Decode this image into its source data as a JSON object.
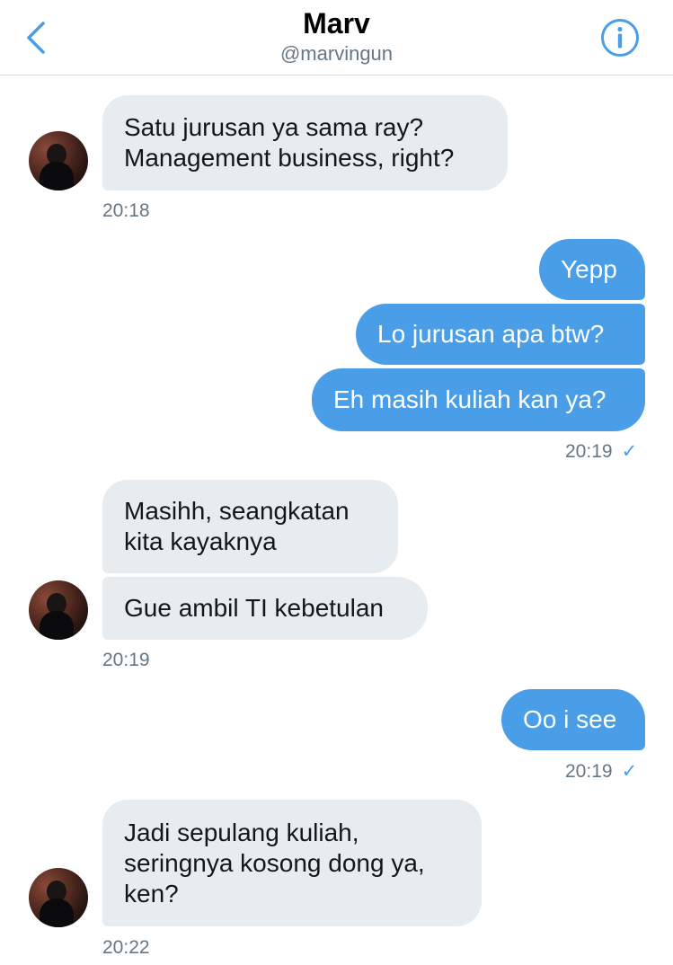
{
  "header": {
    "name": "Marv",
    "handle": "@marvingun"
  },
  "colors": {
    "accent": "#4a9ee8",
    "incoming_bubble": "#e6ecf0",
    "timestamp": "#657786"
  },
  "messages": [
    {
      "direction": "incoming",
      "text": "Satu jurusan ya sama ray?\nManagement business, right?"
    },
    {
      "direction": "outgoing",
      "text": "Yepp"
    },
    {
      "direction": "outgoing",
      "text": "Lo jurusan apa btw?"
    },
    {
      "direction": "outgoing",
      "text": "Eh masih kuliah kan ya?"
    },
    {
      "direction": "incoming",
      "text": "Masihh, seangkatan\nkita kayaknya"
    },
    {
      "direction": "incoming",
      "text": "Gue ambil TI kebetulan"
    },
    {
      "direction": "outgoing",
      "text": "Oo i see"
    },
    {
      "direction": "incoming",
      "text": "Jadi sepulang kuliah,\nseringnya kosong dong ya,\nken?"
    }
  ],
  "timestamps": [
    "20:18",
    "20:19",
    "20:19",
    "20:19",
    "20:22"
  ],
  "read_check": "✓",
  "icons": {
    "back": "chevron-left-icon",
    "info": "info-circle-icon",
    "avatar": "avatar"
  }
}
